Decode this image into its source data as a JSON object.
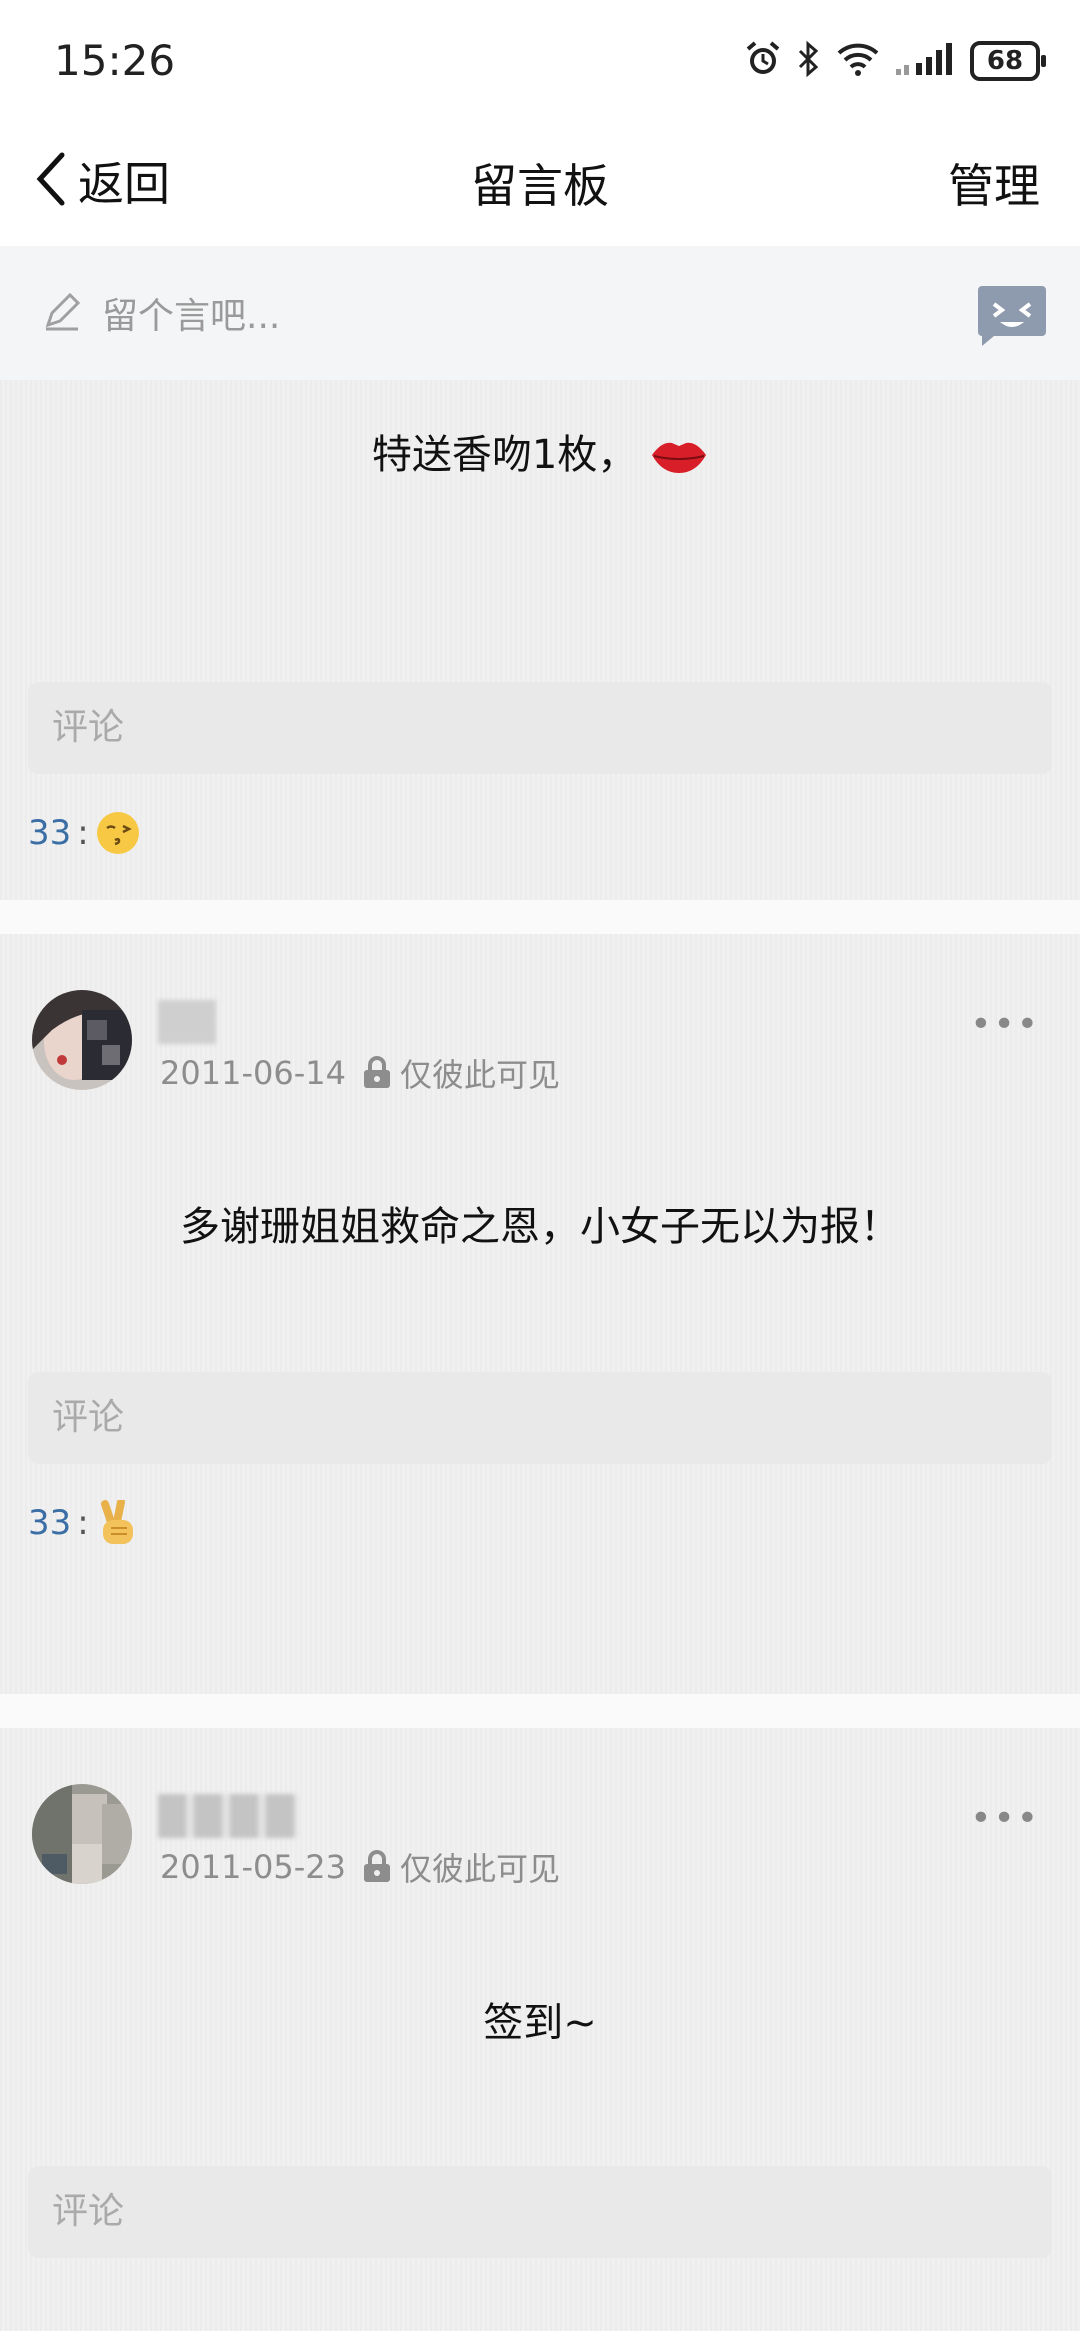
{
  "status_bar": {
    "time": "15:26",
    "battery": "68",
    "icons": [
      "alarm-icon",
      "bluetooth-icon",
      "wifi-icon",
      "signal-icon",
      "battery-icon"
    ]
  },
  "nav": {
    "back_label": "返回",
    "title": "留言板",
    "manage_label": "管理"
  },
  "compose": {
    "placeholder": "留个言吧..."
  },
  "posts": [
    {
      "message": "特送香吻1枚，",
      "message_emoji": "lips",
      "comment_placeholder": "评论",
      "reply_user": "33",
      "reply_colon": ":",
      "reply_emoji": "kissing-face"
    },
    {
      "date": "2011-06-14",
      "visibility": "仅彼此可见",
      "more": "•••",
      "message": "多谢珊姐姐救命之恩，小女子无以为报！",
      "comment_placeholder": "评论",
      "reply_user": "33",
      "reply_colon": ":",
      "reply_emoji": "victory-hand"
    },
    {
      "date": "2011-05-23",
      "visibility": "仅彼此可见",
      "more": "•••",
      "message": "签到~",
      "comment_placeholder": "评论"
    }
  ]
}
